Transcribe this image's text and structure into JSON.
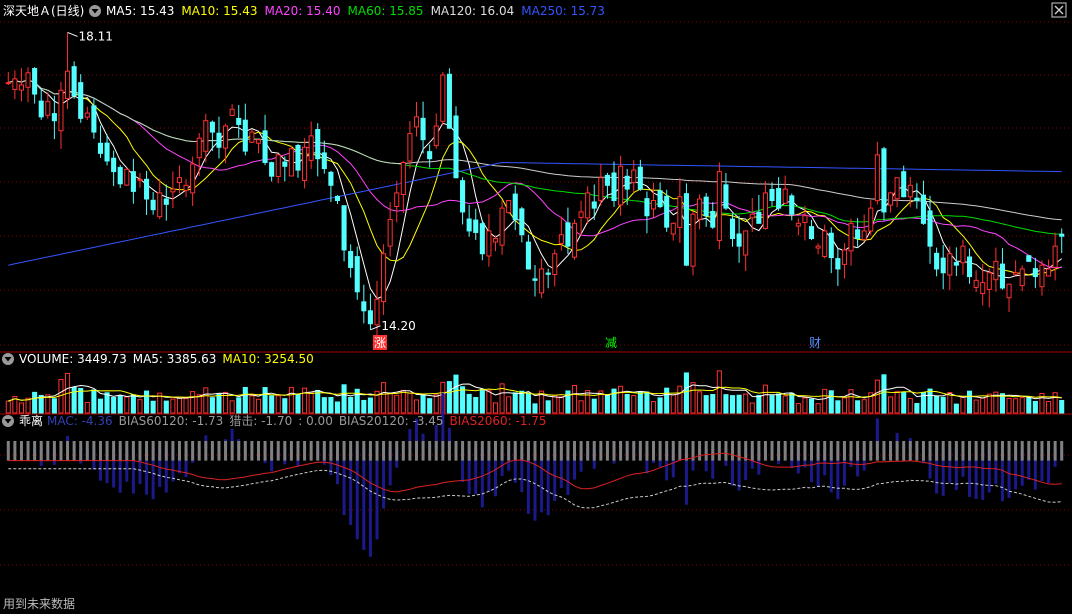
{
  "header": {
    "stock_title": "深天地Ａ(日线)",
    "ma": [
      {
        "label": "MA5: 15.43",
        "color": "#ffffff"
      },
      {
        "label": "MA10: 15.43",
        "color": "#ffff00"
      },
      {
        "label": "MA20: 15.40",
        "color": "#ff44ff"
      },
      {
        "label": "MA60: 15.85",
        "color": "#00dd00"
      },
      {
        "label": "MA120: 16.04",
        "color": "#dddddd"
      },
      {
        "label": "MA250: 15.73",
        "color": "#3355ff"
      }
    ]
  },
  "volume_header": {
    "items": [
      {
        "label": "VOLUME: 3449.73",
        "color": "#ffffff"
      },
      {
        "label": "MA5: 3385.63",
        "color": "#ffffff"
      },
      {
        "label": "MA10: 3254.50",
        "color": "#ffff00"
      }
    ]
  },
  "bias_header": {
    "title": "乖离",
    "items": [
      {
        "label": "MAC: -4.36",
        "color": "#3040b0"
      },
      {
        "label": "BIAS60120: -1.73",
        "color": "#999999"
      },
      {
        "label": "猎击: -1.70",
        "color": "#999999"
      },
      {
        "label": ": 0.00",
        "color": "#999999"
      },
      {
        "label": "BIAS20120: -3.45",
        "color": "#999999"
      },
      {
        "label": "BIAS2060: -1.75",
        "color": "#dd2222"
      }
    ]
  },
  "footer_note": "用到未来数据",
  "colors": {
    "up": "#ff3030",
    "down": "#54ffff",
    "grid": "#8b0000",
    "bias_bar": "#1a1a8c",
    "bias_pos": "#808080"
  },
  "chart_data": {
    "type": "candlestick",
    "price_ylim": [
      14.0,
      18.3
    ],
    "annotations": [
      {
        "text": "18.11",
        "type": "high",
        "value": 18.11
      },
      {
        "text": "14.20",
        "type": "low",
        "value": 14.2
      }
    ],
    "event_markers": [
      {
        "text": "涨",
        "color": "#ff3030",
        "bg": "#ff3030"
      },
      {
        "text": "减",
        "color": "#00ff00",
        "bg": null
      },
      {
        "text": "财",
        "color": "#5590ff",
        "bg": null
      }
    ],
    "candles_close": [
      17.45,
      17.5,
      17.42,
      17.58,
      17.3,
      17.0,
      17.2,
      16.95,
      17.35,
      17.6,
      17.28,
      16.98,
      17.05,
      16.8,
      16.52,
      16.42,
      16.28,
      16.12,
      16.31,
      16.02,
      16.18,
      15.92,
      15.78,
      16.0,
      15.85,
      16.05,
      16.2,
      16.1,
      16.38,
      16.72,
      16.95,
      16.8,
      16.6,
      16.88,
      17.1,
      16.9,
      16.55,
      16.8,
      16.7,
      16.4,
      16.22,
      16.5,
      16.35,
      16.58,
      16.3,
      16.6,
      16.75,
      16.45,
      16.32,
      16.1,
      15.9,
      15.25,
      15.02,
      14.7,
      14.45,
      14.28,
      14.6,
      15.2,
      15.65,
      16.0,
      16.4,
      16.78,
      17.0,
      16.7,
      16.45,
      16.88,
      17.55,
      16.85,
      16.2,
      15.75,
      15.5,
      15.48,
      15.2,
      15.5,
      15.4,
      15.8,
      15.9,
      15.65,
      15.45,
      15.0,
      14.85,
      15.0,
      14.93,
      15.2,
      15.45,
      15.3,
      15.6,
      15.75,
      16.0,
      15.8,
      16.2,
      16.1,
      15.9,
      16.35,
      16.05,
      16.3,
      16.05,
      15.7,
      15.9,
      15.82,
      15.55,
      15.6,
      15.95,
      15.05,
      15.72,
      15.92,
      15.7,
      15.55,
      16.28,
      15.8,
      15.4,
      15.3,
      15.5,
      15.72,
      15.6,
      16.0,
      15.9,
      15.8,
      16.05,
      15.72,
      15.6,
      15.7,
      15.4,
      15.3,
      15.5,
      15.15,
      15.0,
      15.25,
      15.6,
      15.4,
      15.5,
      15.8,
      16.5,
      15.75,
      16.0,
      16.2,
      15.95,
      16.1,
      15.9,
      15.6,
      15.3,
      15.0,
      14.95,
      15.2,
      15.05,
      15.3,
      14.9,
      14.85,
      14.82,
      14.95,
      15.1,
      14.75,
      14.8,
      14.95,
      15.0,
      15.1,
      14.9,
      15.05,
      15.0,
      15.3,
      15.43
    ],
    "volume_ylim": [
      0,
      5000
    ],
    "bias_ylim": [
      -20,
      2
    ]
  }
}
